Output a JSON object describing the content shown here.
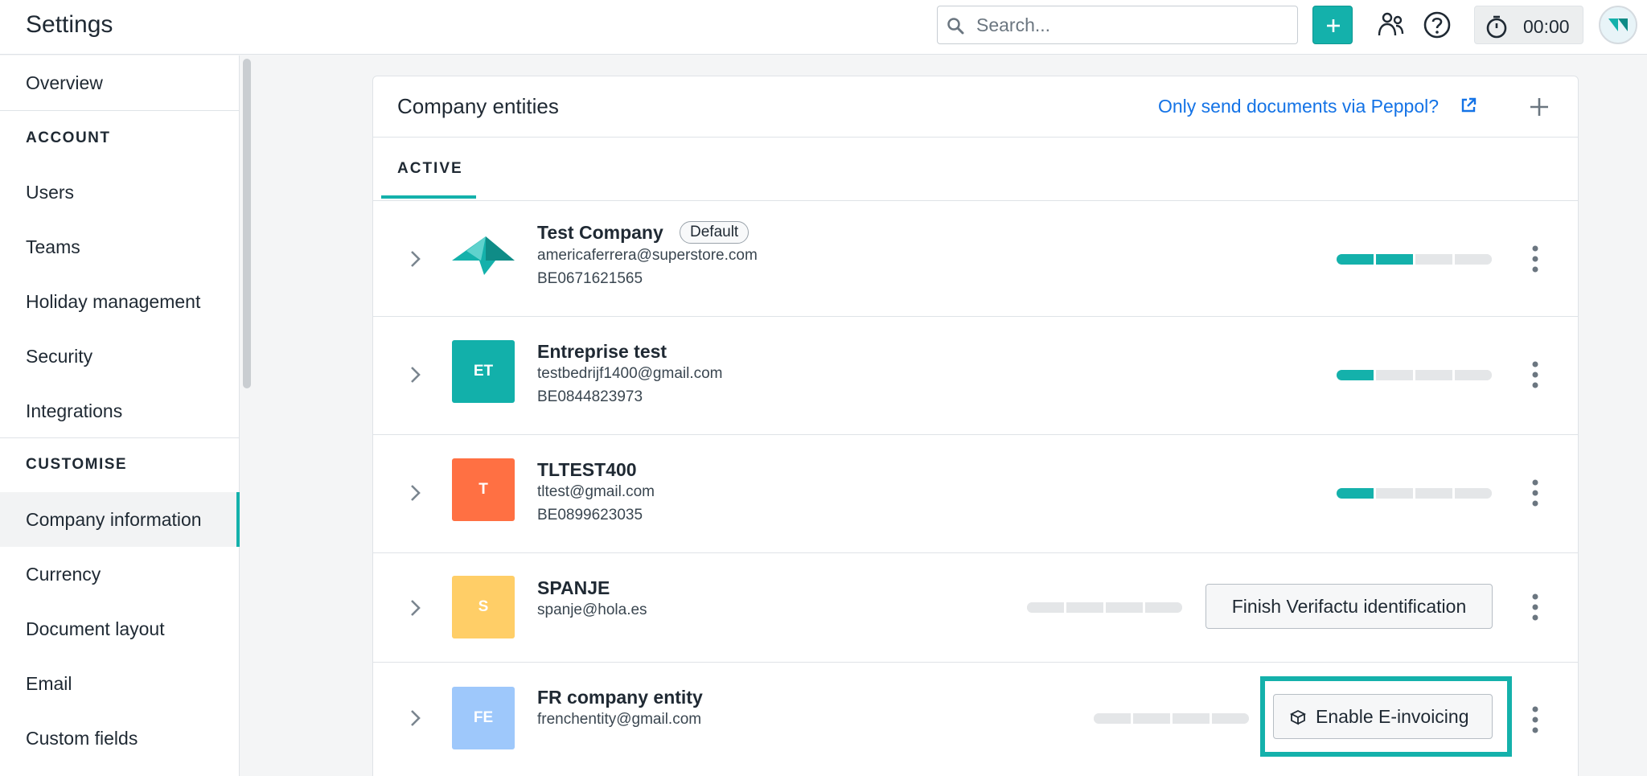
{
  "app": {
    "title": "Settings"
  },
  "topbar": {
    "search_placeholder": "Search...",
    "timer": "00:00",
    "icons": [
      "search-icon",
      "plus-icon",
      "people-icon",
      "help-icon",
      "stopwatch-icon",
      "avatar"
    ]
  },
  "sidebar": {
    "overview": "Overview",
    "sections": [
      {
        "title": "ACCOUNT",
        "items": [
          "Users",
          "Teams",
          "Holiday management",
          "Security",
          "Integrations"
        ]
      },
      {
        "title": "CUSTOMISE",
        "items": [
          "Company information",
          "Currency",
          "Document layout",
          "Email",
          "Custom fields"
        ]
      }
    ],
    "active_item": "Company information"
  },
  "card": {
    "title": "Company entities",
    "peppol_link": "Only send documents via Peppol?",
    "tab_active": "ACTIVE"
  },
  "entities": [
    {
      "name": "Test Company",
      "badge": "Default",
      "email": "americaferrera@superstore.com",
      "vat": "BE0671621565",
      "logo": "teal-bird-logo",
      "progress_steps_done": 2,
      "progress_steps_total": 4
    },
    {
      "name": "Entreprise test",
      "initials": "ET",
      "email": "testbedrijf1400@gmail.com",
      "vat": "BE0844823973",
      "color": "#12b0aa",
      "progress_steps_done": 1,
      "progress_steps_total": 4
    },
    {
      "name": "TLTEST400",
      "initials": "T",
      "email": "tltest@gmail.com",
      "vat": "BE0899623035",
      "color": "#ff7043",
      "progress_steps_done": 1,
      "progress_steps_total": 4
    },
    {
      "name": "SPANJE",
      "initials": "S",
      "email": "spanje@hola.es",
      "color": "#ffce67",
      "progress_steps_done": 0,
      "progress_steps_total": 4,
      "action": "Finish Verifactu identification"
    },
    {
      "name": "FR company entity",
      "initials": "FE",
      "email": "frenchentity@gmail.com",
      "color": "#9ec8fb",
      "progress_steps_done": 0,
      "progress_steps_total": 4,
      "action": "Enable E-invoicing"
    }
  ],
  "colors": {
    "accent": "#14b1ab",
    "link": "#1473e6"
  }
}
